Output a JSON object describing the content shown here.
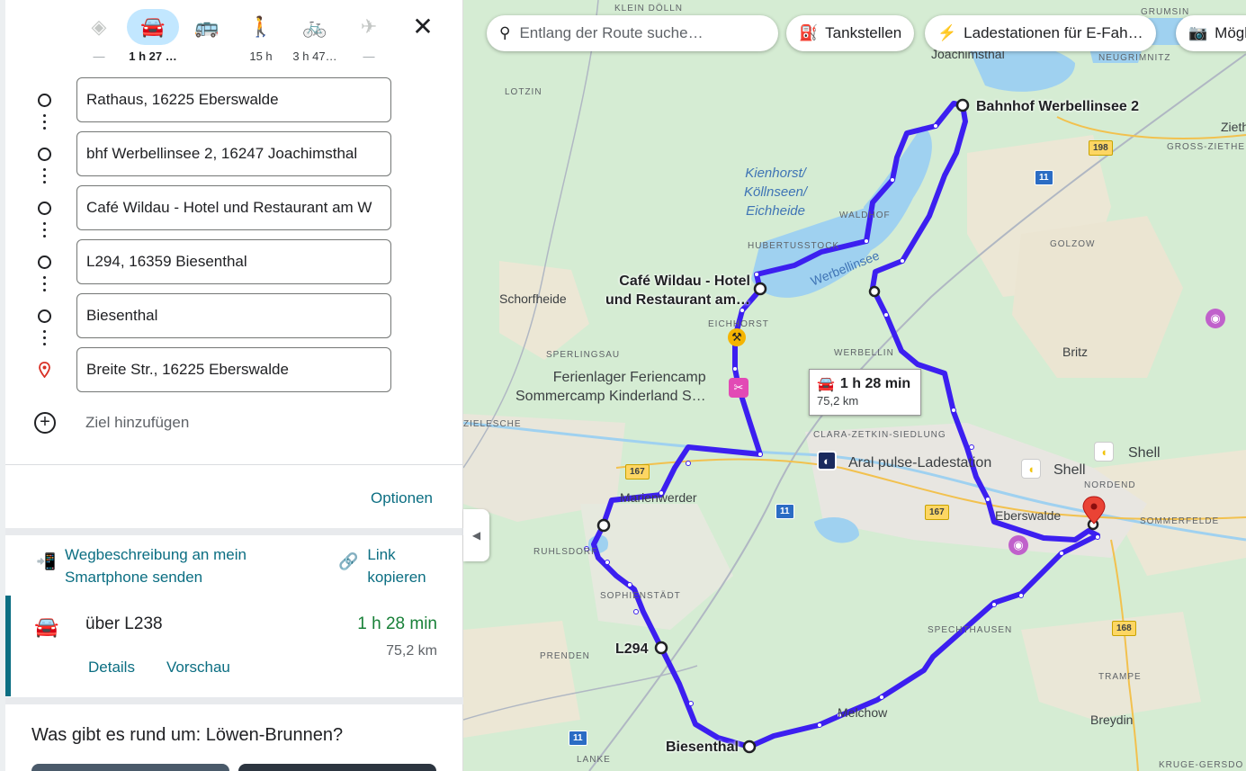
{
  "travel_modes": [
    {
      "name": "best",
      "icon": "directions-icon",
      "time": "—"
    },
    {
      "name": "car",
      "icon": "car-icon",
      "time": "1 h 27 …"
    },
    {
      "name": "transit",
      "icon": "bus-icon",
      "time": ""
    },
    {
      "name": "walk",
      "icon": "walk-icon",
      "time": "15 h"
    },
    {
      "name": "bike",
      "icon": "bike-icon",
      "time": "3 h 47…"
    },
    {
      "name": "flight",
      "icon": "plane-icon",
      "time": "—"
    }
  ],
  "stops": [
    "Rathaus, 16225 Eberswalde",
    "bhf Werbellinsee 2, 16247 Joachimsthal",
    "Café Wildau - Hotel und Restaurant am W",
    "L294, 16359 Biesenthal",
    "Biesenthal",
    "Breite Str., 16225 Eberswalde"
  ],
  "add_destination": "Ziel hinzufügen",
  "options_label": "Optionen",
  "share": {
    "send_phone": "Wegbeschreibung an mein Smartphone senden",
    "copy_link": "Link kopieren"
  },
  "route": {
    "via": "über L238",
    "duration": "1 h 28 min",
    "distance": "75,2 km",
    "details": "Details",
    "preview": "Vorschau"
  },
  "nearby_title": "Was gibt es rund um: Löwen-Brunnen?",
  "map": {
    "search_placeholder": "Entlang der Route suche…",
    "chips": [
      "Tankstellen",
      "Ladestationen für E-Fah…",
      "Mögl"
    ],
    "tooltip_duration": "1 h 28 min",
    "tooltip_distance": "75,2 km",
    "labels": {
      "klein_doelln": "KLEIN DÖLLN",
      "grumsin": "GRUMSIN",
      "joachimsthal": "Joachimsthal",
      "neugrimnitz": "NEUGRIMNITZ",
      "lotzin": "LOTZIN",
      "bahnhof": "Bahnhof Werbellinsee 2",
      "zieth": "Zieth",
      "gross_ziethen": "GROSS-ZIETHE",
      "kienhorst": "Kienhorst/\nKöllnseen/\nEichheide",
      "waldhof": "WALDHOF",
      "hubertusstock": "HUBERTUSSTOCK",
      "golzow": "GOLZOW",
      "werbellinsee": "Werbellinsee",
      "schorfheide": "Schorfheide",
      "cafe": "Café Wildau - Hotel\nund Restaurant am…",
      "eichhorst": "EICHHORST",
      "sperlingsau": "SPERLINGSAU",
      "werbellin": "WERBELLIN",
      "britz": "Britz",
      "ferienlager": "Ferienlager Feriencamp\nSommercamp Kinderland S…",
      "zieleschl": "ZIELESCHE",
      "clara": "CLARA-ZETKIN-SIEDLUNG",
      "aral": "Aral pulse-Ladestation",
      "shell1": "Shell",
      "shell2": "Shell",
      "nordend": "NORDEND",
      "marienwerder": "Marienwerder",
      "eberswalde": "Eberswalde",
      "sommerfelde": "SOMMERFELDE",
      "ruhlsdorf": "RUHLSDORF",
      "sophienstaedt": "SOPHIENSTÄDT",
      "spechthausen": "SPECHTHAUSEN",
      "l294": "L294",
      "prenden": "PRENDEN",
      "trampe": "TRAMPE",
      "melchow": "Melchow",
      "breydin": "Breydin",
      "biesenthal": "Biesenthal",
      "lanke": "LANKE",
      "kruge": "KRUGE-GERSDO"
    },
    "shields": {
      "r198": "198",
      "r11a": "11",
      "r167a": "167",
      "r167b": "167",
      "r11b": "11",
      "r168": "168",
      "r11c": "11"
    },
    "colors": {
      "route": "#3c1ff0",
      "land": "#d5ecd3",
      "water": "#9fd1f0",
      "urban": "#e8e6e1"
    }
  }
}
